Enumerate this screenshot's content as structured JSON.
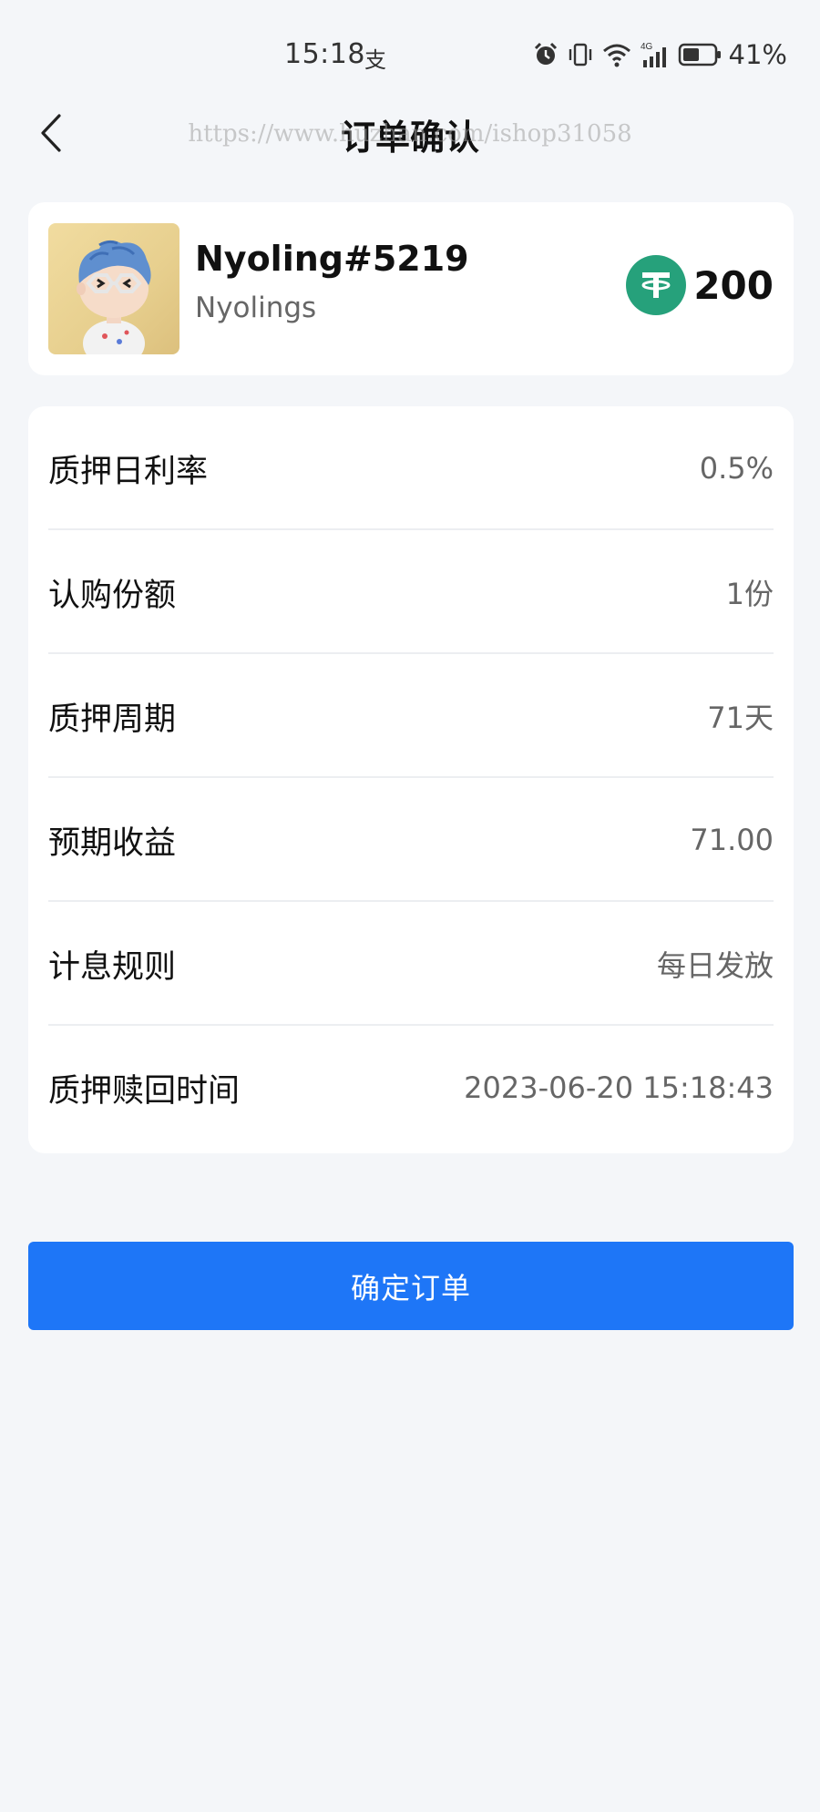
{
  "status_bar": {
    "time": "15:18",
    "extra": "支",
    "network_label": "4G",
    "battery": "41%"
  },
  "nav": {
    "title": "订单确认",
    "watermark": "https://www.huzhan.com/ishop31058"
  },
  "product": {
    "name": "Nyoling#5219",
    "collection": "Nyolings",
    "currency_icon": "usdt-icon",
    "price": "200"
  },
  "details": [
    {
      "label": "质押日利率",
      "value": "0.5%"
    },
    {
      "label": "认购份额",
      "value": "1份"
    },
    {
      "label": "质押周期",
      "value": "71天"
    },
    {
      "label": "预期收益",
      "value": "71.00"
    },
    {
      "label": "计息规则",
      "value": "每日发放"
    },
    {
      "label": "质押赎回时间",
      "value": "2023-06-20 15:18:43"
    }
  ],
  "confirm_button": {
    "label": "确定订单"
  },
  "colors": {
    "primary": "#1e76f7",
    "usdt": "#26a17b",
    "background": "#f4f6f9"
  }
}
